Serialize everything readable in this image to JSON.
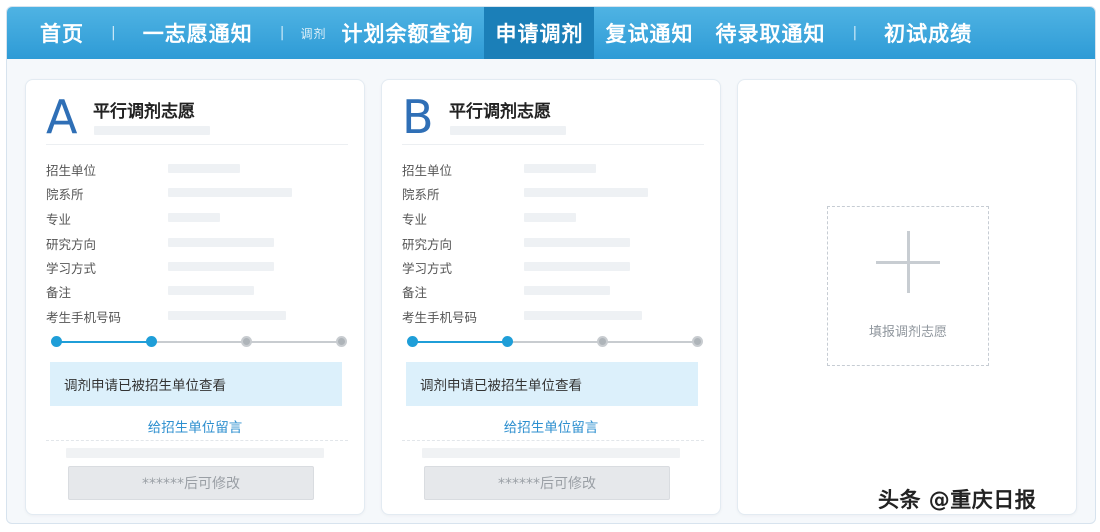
{
  "nav": {
    "items": [
      {
        "label": "首页"
      },
      {
        "label": "一志愿通知"
      },
      {
        "label": "计划余额查询",
        "prefix": "调剂"
      },
      {
        "label": "申请调剂",
        "active": true
      },
      {
        "label": "复试通知"
      },
      {
        "label": "待录取通知"
      },
      {
        "label": "初试成绩"
      }
    ],
    "separator": "|"
  },
  "cards": [
    {
      "letter": "A",
      "title": "平行调剂志愿",
      "fields": [
        "招生单位",
        "院系所",
        "专业",
        "研究方向",
        "学习方式",
        "备注",
        "考生手机号码"
      ],
      "progress_steps_completed": 2,
      "progress_steps_total": 4,
      "notice": "调剂申请已被招生单位查看",
      "message_link": "给招生单位留言",
      "edit_button": "******后可修改"
    },
    {
      "letter": "B",
      "title": "平行调剂志愿",
      "fields": [
        "招生单位",
        "院系所",
        "专业",
        "研究方向",
        "学习方式",
        "备注",
        "考生手机号码"
      ],
      "progress_steps_completed": 2,
      "progress_steps_total": 4,
      "notice": "调剂申请已被招生单位查看",
      "message_link": "给招生单位留言",
      "edit_button": "******后可修改"
    }
  ],
  "add_card": {
    "label": "填报调剂志愿",
    "icon": "plus-icon"
  },
  "watermark": "头条 @重庆日报",
  "colors": {
    "nav_bg": "#2e9bd6",
    "nav_active": "#1b7fb8",
    "accent": "#1f9ed8",
    "letter": "#2f6fb6",
    "notice_bg": "#dcf0fb",
    "link": "#2d8fcf"
  }
}
